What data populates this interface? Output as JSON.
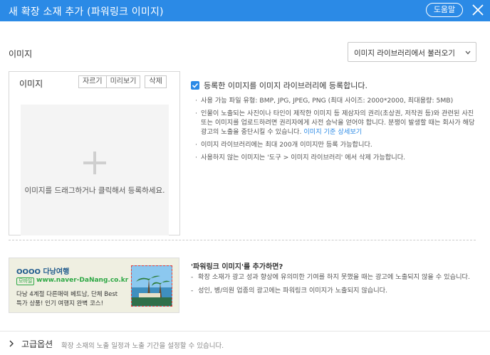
{
  "header": {
    "title": "새 확장 소재 추가 (파워링크 이미지)",
    "help_label": "도움말"
  },
  "section": {
    "image_label": "이미지",
    "library_select_label": "이미지 라이브러리에서 불러오기"
  },
  "image_box": {
    "title": "이미지",
    "buttons": [
      "자르기",
      "미리보기",
      "삭제"
    ],
    "drop_text": "이미지를 드래그하거나 클릭해서 등록하세요."
  },
  "register": {
    "checked": true,
    "label": "등록한 이미지를 이미지 라이브러리에 등록합니다."
  },
  "notes": [
    "사용 가능 파일 유형: BMP, JPG, JPEG, PNG (최대 사이즈: 2000*2000, 최대용량: 5MB)",
    "인물이 노출되는 사진이나 타인이 제작한 이미지 등 제삼자의 권리(초상권, 저작권 등)와 관련된 사진 또는 이미지를 업로드하려면 권리자에게 사전 승낙을 얻어야 합니다. 분쟁이 발생할 때는 회사가 해당 광고의 노출을 중단시킬 수 있습니다.",
    "이미지 라이브러리에는 최대 200개 이미지만 등록 가능합니다.",
    "사용하지 않는 이미지는 '도구 > 이미지 라이브러리' 에서 삭제 가능합니다."
  ],
  "notes_link": "이미지 기준 상세보기",
  "ad_preview": {
    "title": "OOOO 다낭여행",
    "badge": "모바일",
    "url": "www.naver-DaNang.co.kr",
    "desc_line1": "다낭 4계절 다른매력 베트남, 단체 Best",
    "desc_line2": "특가 상품! 인기 여행지 완벽 코스!"
  },
  "info": {
    "title": "'파워링크 이미지'를 추가하면?",
    "notes": [
      "확장 소재가 광고 성과 향상에 유의미한 기여를 하지 못했을 때는 광고에 노출되지 않을 수 있습니다.",
      "성인, 병/의원 업종의 광고에는 파워링크 이미지가 노출되지 않습니다."
    ]
  },
  "footer": {
    "advanced_label": "고급옵션",
    "advanced_desc": "확장 소재의 노출 일정과 노출 기간을 설정할 수 있습니다."
  },
  "colors": {
    "accent": "#2b8ae6",
    "ad_bg": "#efefe1",
    "url_green": "#2ea845"
  },
  "icons": [
    "close-icon",
    "chevron-down-icon",
    "plus-icon",
    "check-icon",
    "chevron-right-icon"
  ]
}
